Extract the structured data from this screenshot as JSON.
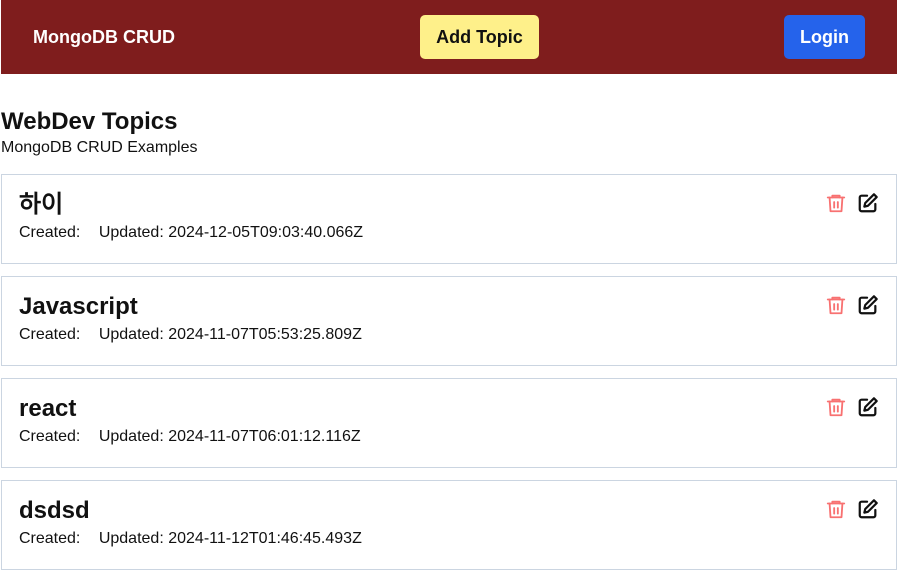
{
  "navbar": {
    "brand": "MongoDB CRUD",
    "add_topic_label": "Add Topic",
    "login_label": "Login"
  },
  "page": {
    "title": "WebDev Topics",
    "subtitle": "MongoDB CRUD Examples"
  },
  "topics": [
    {
      "title": "하이",
      "created_label": "Created:",
      "updated_label": "Updated:",
      "updated": "2024-12-05T09:03:40.066Z"
    },
    {
      "title": "Javascript",
      "created_label": "Created:",
      "updated_label": "Updated:",
      "updated": "2024-11-07T05:53:25.809Z"
    },
    {
      "title": "react",
      "created_label": "Created:",
      "updated_label": "Updated:",
      "updated": "2024-11-07T06:01:12.116Z"
    },
    {
      "title": "dsdsd",
      "created_label": "Created:",
      "updated_label": "Updated:",
      "updated": "2024-11-12T01:46:45.493Z"
    }
  ],
  "icons": {
    "delete": "trash-icon",
    "edit": "edit-icon"
  },
  "colors": {
    "navbar_bg": "#7f1d1d",
    "add_button_bg": "#fef08a",
    "login_button_bg": "#2563eb",
    "delete_icon": "#f87171",
    "card_border": "#cbd5e1"
  }
}
